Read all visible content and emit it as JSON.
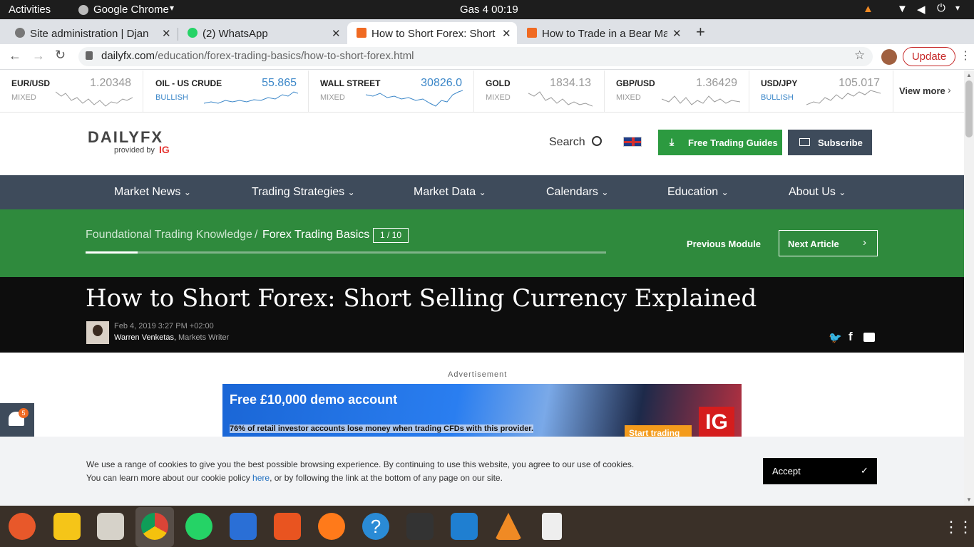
{
  "system_bar": {
    "activities": "Activities",
    "app_name": "Google Chrome",
    "clock": "Gas 4  00:19"
  },
  "tabs": [
    {
      "title": "Site administration | Djan",
      "active": false
    },
    {
      "title": "(2) WhatsApp",
      "active": false
    },
    {
      "title": "How to Short Forex: Short",
      "active": true
    },
    {
      "title": "How to Trade in a Bear Ma",
      "active": false
    }
  ],
  "omnibox": {
    "url_host": "dailyfx.com",
    "url_path": "/education/forex-trading-basics/how-to-short-forex.html"
  },
  "update_button": "Update",
  "ticker": [
    {
      "name": "EUR/USD",
      "status": "MIXED",
      "price": "1.20348",
      "color": "#999999"
    },
    {
      "name": "OIL - US CRUDE",
      "status": "BULLISH",
      "price": "55.865",
      "color": "#3a86c8"
    },
    {
      "name": "WALL STREET",
      "status": "MIXED",
      "price": "30826.0",
      "color": "#3a86c8"
    },
    {
      "name": "GOLD",
      "status": "MIXED",
      "price": "1834.13",
      "color": "#999999"
    },
    {
      "name": "GBP/USD",
      "status": "MIXED",
      "price": "1.36429",
      "color": "#999999"
    },
    {
      "name": "USD/JPY",
      "status": "BULLISH",
      "price": "105.017",
      "color": "#999999"
    }
  ],
  "view_more": "View more",
  "logo": {
    "main": "DAILYFX",
    "sub": "provided by",
    "brand": "IG"
  },
  "header": {
    "search_label": "Search",
    "guides_button": "Free Trading Guides",
    "subscribe_button": "Subscribe"
  },
  "nav": [
    "Market News",
    "Trading Strategies",
    "Market Data",
    "Calendars",
    "Education",
    "About Us"
  ],
  "course": {
    "crumb1": "Foundational Trading Knowledge",
    "sep": "/",
    "crumb2": "Forex Trading Basics",
    "counter": "1 / 10",
    "progress": 0.1,
    "prev": "Previous Module",
    "next": "Next Article"
  },
  "article": {
    "title": "How to Short Forex: Short Selling Currency Explained",
    "date": "Feb 4, 2019 3:27 PM +02:00",
    "author": "Warren Venketas,",
    "role": "Markets Writer"
  },
  "ad": {
    "label": "Advertisement",
    "headline": "Free £10,000 demo account",
    "disclaimer": "76% of retail investor accounts lose money when trading CFDs with this provider.",
    "cta": "Start trading",
    "brand": "IG"
  },
  "notification_count": "5",
  "cookie": {
    "line1": "We use a range of cookies to give you the best possible browsing experience. By continuing to use this website, you agree to our use of cookies.",
    "line2a": "You can learn more about our cookie policy ",
    "link": "here",
    "line2b": ", or by following the link at the bottom of any page on our site.",
    "accept": "Accept"
  },
  "colors": {
    "green": "#2f8a3d",
    "nav": "#3e4b5b",
    "guides": "#2c9a40",
    "accent_red": "#c62828"
  }
}
